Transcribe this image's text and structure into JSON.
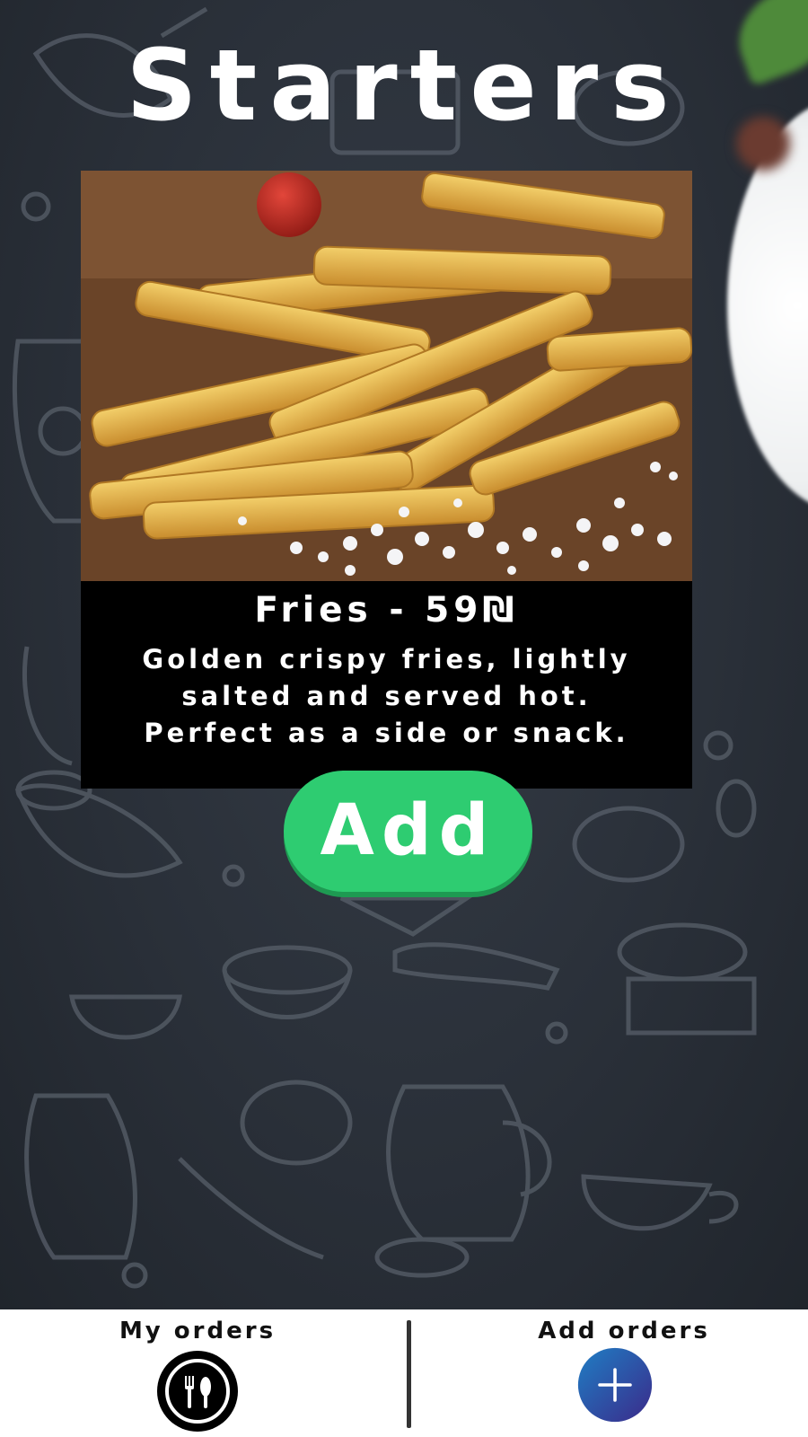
{
  "page": {
    "title": "Starters"
  },
  "item": {
    "name": "Fries - 59₪",
    "description_lines": [
      "Golden crispy fries, lightly",
      "salted and served hot.",
      "Perfect as a side or snack."
    ],
    "add_label": "Add"
  },
  "bottom_nav": {
    "my_orders": {
      "label": "My orders",
      "icon": "plate-cutlery-icon"
    },
    "add_orders": {
      "label": "Add orders",
      "icon": "plus-circle-icon"
    }
  },
  "colors": {
    "add_button": "#2ecc71",
    "bottom_bar": "#ffffff",
    "card": "#000000",
    "add_orders_icon_start": "#1f7ec4",
    "add_orders_icon_end": "#3b2a8a"
  }
}
